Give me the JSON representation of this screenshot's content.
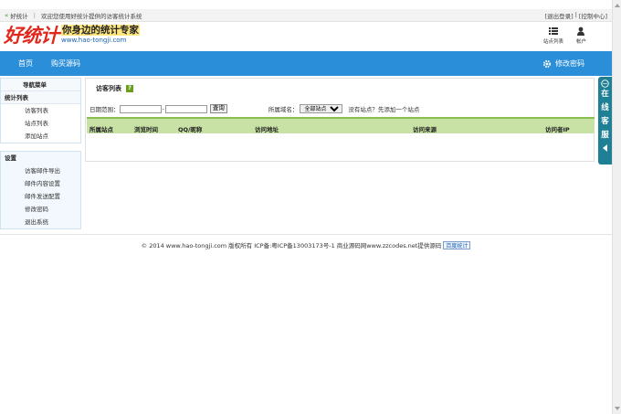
{
  "topbar": {
    "brand": "好统计",
    "welcome": "欢迎您使用好统计提供的访客统计系统",
    "logout": "[退出登录]",
    "divider": "|",
    "control": "[控制中心]"
  },
  "header": {
    "logo": "好统计",
    "slogan": "你身边的统计专家",
    "url": "www.hao-tongji.com",
    "tools": [
      {
        "label": "站点列表",
        "icon": "list-icon"
      },
      {
        "label": "帐户",
        "icon": "user-icon"
      }
    ]
  },
  "nav": {
    "items": [
      "首页",
      "购买源码"
    ],
    "right": "修改密码",
    "right_icon": "gear-icon"
  },
  "sidebar": {
    "menu_title": "导航菜单",
    "section1_title": "统计列表",
    "section1_items": [
      "访客列表",
      "站点列表",
      "添加站点"
    ],
    "section2_title": "设置",
    "section2_items": [
      "访客邮件导出",
      "邮件内容设置",
      "邮件发送配置",
      "修改密码",
      "退出系统"
    ]
  },
  "main": {
    "title": "访客列表",
    "help": "?",
    "filter": {
      "date_label": "日期范围：",
      "date_start": "",
      "date_end": "",
      "dash": "-",
      "query": "查询",
      "domain_label": "所属域名：",
      "domain_selected": "全部站点",
      "hint": "没有站点？先添加一个站点"
    },
    "columns": [
      "所属站点",
      "浏览时间",
      "QQ/昵称",
      "访问地址",
      "访问来源",
      "访问者IP"
    ]
  },
  "footer": {
    "text": "© 2014 www.hao-tongji.com 版权所有 ICP备:粤ICP备13003173号-1 商业源码网www.zzcodes.net提供源码",
    "badge": "百度统计"
  },
  "float": {
    "chars": [
      "在",
      "线",
      "客",
      "服"
    ]
  },
  "colors": {
    "nav": "#2b8ed8",
    "table_header": "#c8e2a6",
    "float": "#1f7f95",
    "logo": "#e0281d"
  }
}
